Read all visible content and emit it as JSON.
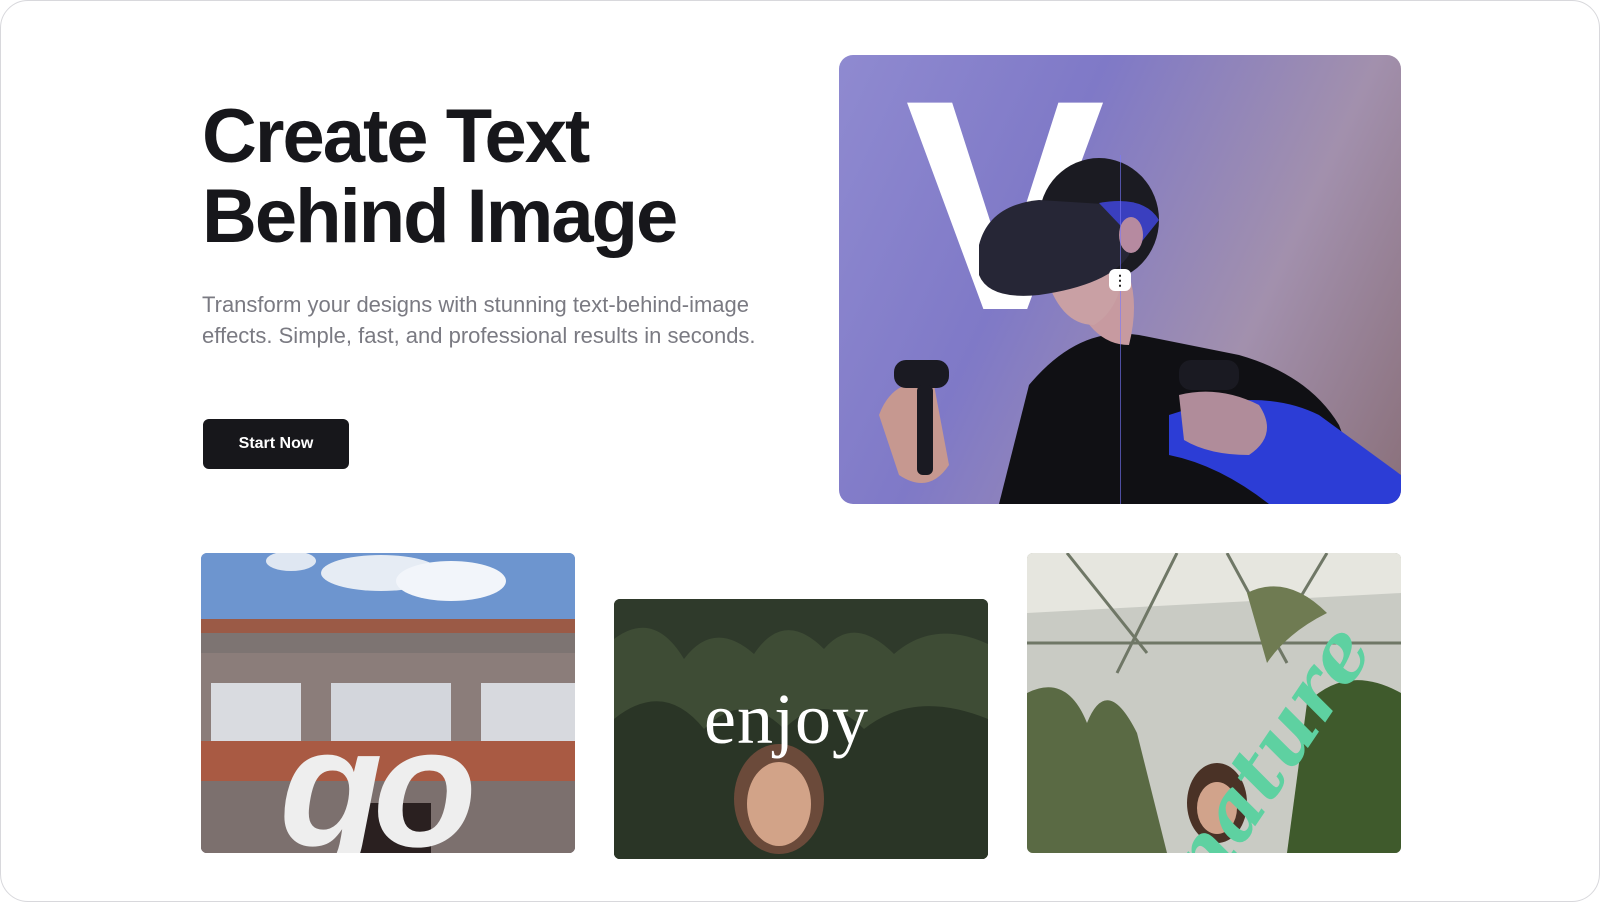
{
  "hero": {
    "title_line1": "Create Text",
    "title_line2": "Behind Image",
    "subtitle": "Transform your designs with stunning text-behind-image effects. Simple, fast, and professional results in seconds.",
    "cta_label": "Start Now"
  },
  "hero_image": {
    "overlay_text": "V",
    "handle_glyph": "⋮"
  },
  "gallery": {
    "cards": [
      {
        "overlay_text": "go"
      },
      {
        "overlay_text": "enjoy"
      },
      {
        "overlay_text": "nature"
      }
    ]
  },
  "colors": {
    "primary": "#17171b",
    "subtitle": "#7a7a82",
    "accent_green": "#5ed1a1"
  }
}
